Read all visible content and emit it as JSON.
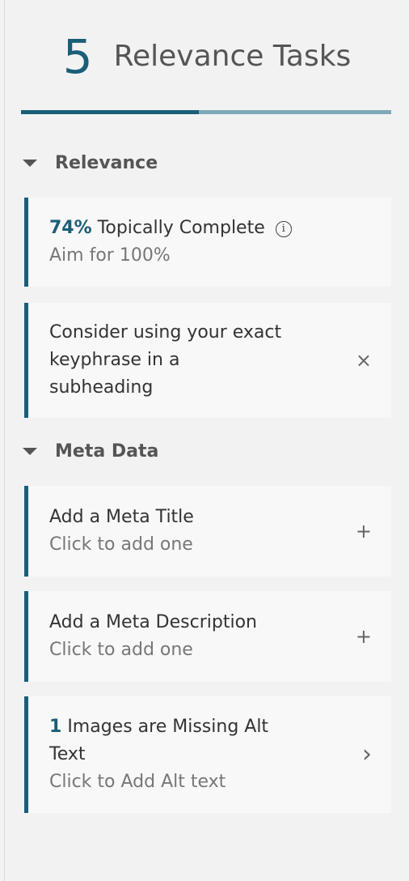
{
  "header": {
    "task_count": "5",
    "title": "Relevance Tasks",
    "progress_fraction": 0.48
  },
  "colors": {
    "accent": "#1a5e78",
    "progress_remaining": "#7ea9b9",
    "card_background": "#f8f8f8"
  },
  "sections": {
    "relevance": {
      "title": "Relevance",
      "cards": {
        "topical": {
          "percent": "74%",
          "label": "Topically Complete",
          "info_icon": "info-icon",
          "sub": "Aim for 100%"
        },
        "keyphrase": {
          "line1": "Consider using your exact",
          "line2": "keyphrase in a",
          "line3": "subheading",
          "action_icon": "close-icon",
          "action_glyph": "×"
        }
      }
    },
    "meta": {
      "title": "Meta Data",
      "cards": {
        "meta_title": {
          "label": "Add a Meta Title",
          "sub": "Click to add one",
          "action_icon": "plus-icon",
          "action_glyph": "+"
        },
        "meta_description": {
          "label": "Add a Meta Description",
          "sub": "Click to add one",
          "action_icon": "plus-icon",
          "action_glyph": "+"
        },
        "alt_text": {
          "count": "1",
          "line1": "Images are Missing Alt",
          "line2": "Text",
          "sub": "Click to Add Alt text",
          "action_icon": "chevron-right-icon",
          "action_glyph": "›"
        }
      }
    }
  }
}
